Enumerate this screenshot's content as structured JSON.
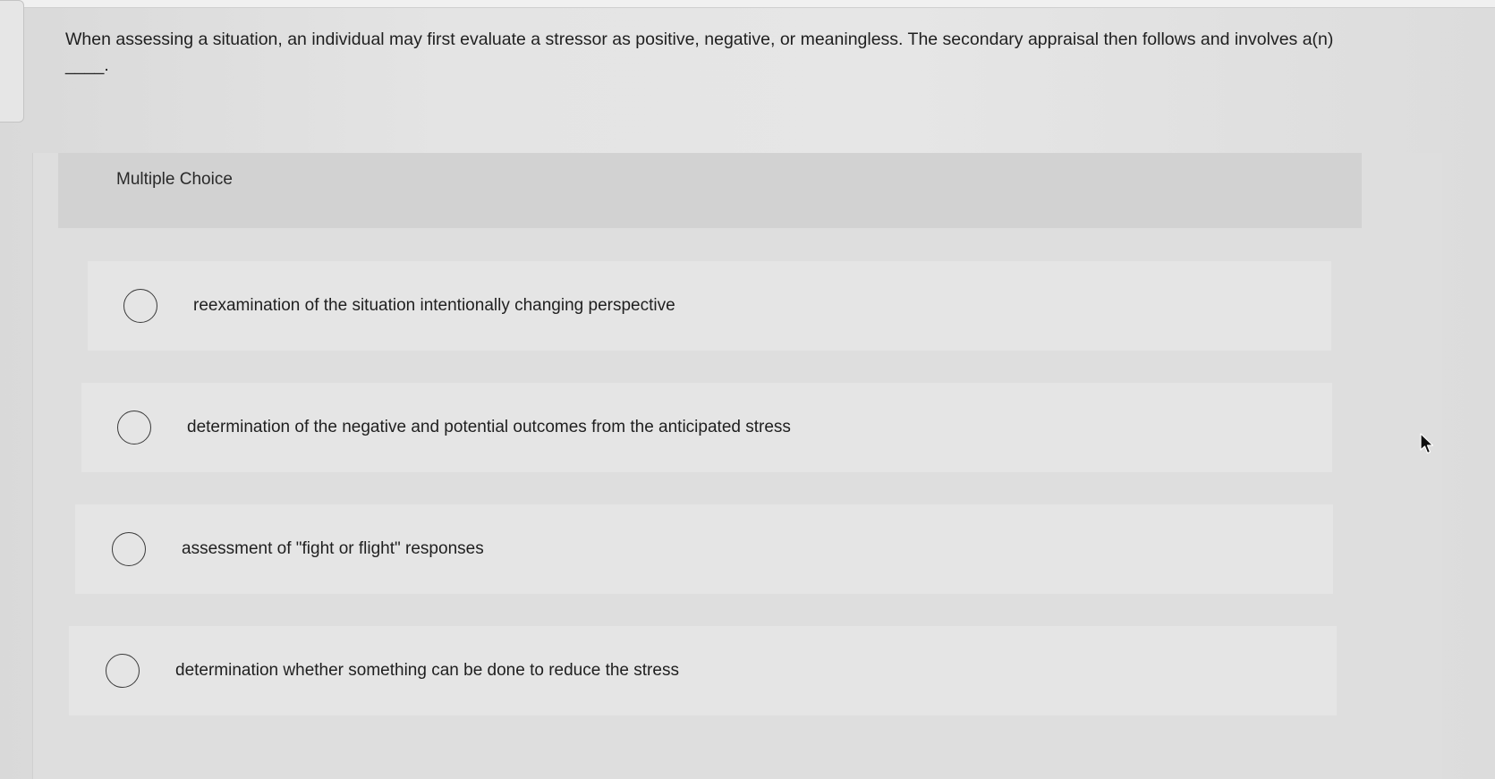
{
  "question": {
    "text": "When assessing a situation, an individual may first evaluate a stressor as positive, negative, or meaningless. The secondary appraisal then follows and involves a(n) ____."
  },
  "panel": {
    "title": "Multiple Choice"
  },
  "options": [
    {
      "label": "reexamination of the situation intentionally changing perspective",
      "selected": false
    },
    {
      "label": "determination of the negative and potential outcomes from the anticipated stress",
      "selected": false
    },
    {
      "label": "assessment of \"fight or flight\" responses",
      "selected": false
    },
    {
      "label": "determination whether something can be done to reduce the stress",
      "selected": false
    }
  ],
  "icons": {
    "cursor": "mouse-pointer-icon",
    "radio": "radio-button-icon"
  },
  "colors": {
    "background": "#e4e4e4",
    "panel": "#dedede",
    "option_card": "#e5e5e5",
    "text": "#1f1f1f"
  }
}
